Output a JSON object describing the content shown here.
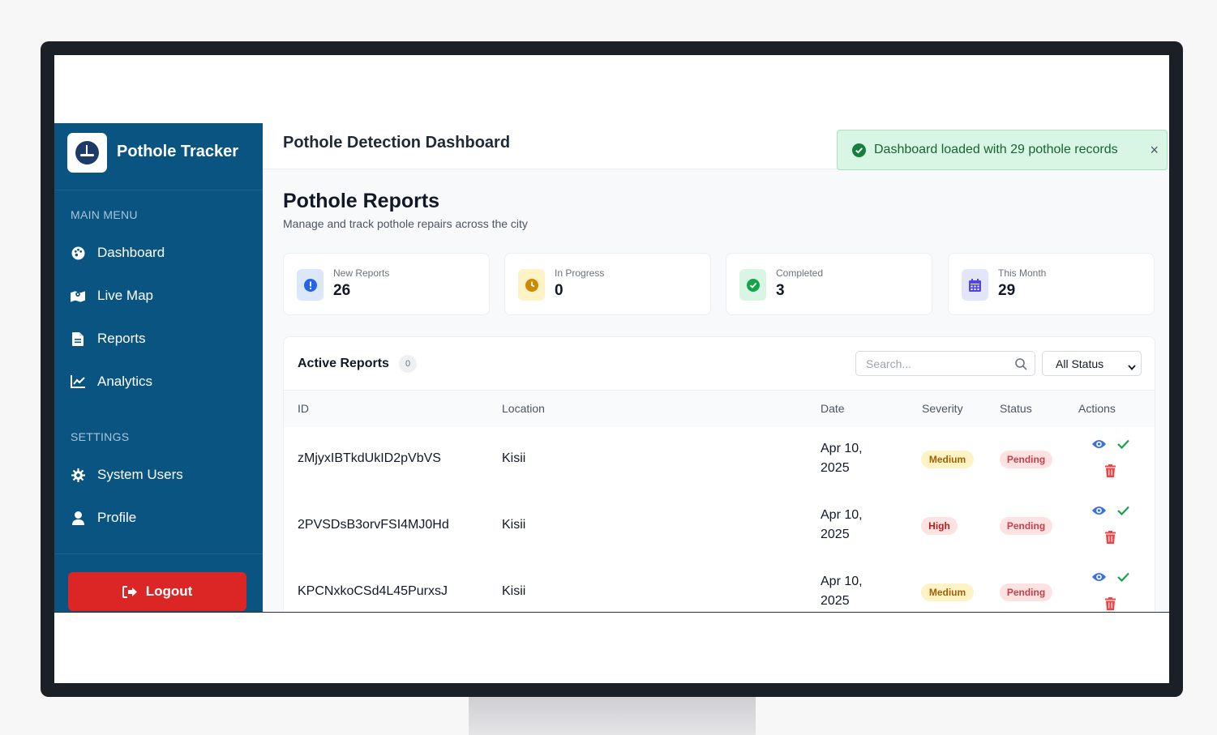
{
  "sidebar": {
    "brand": "Pothole Tracker",
    "main_menu_label": "MAIN MENU",
    "main_items": [
      {
        "label": "Dashboard",
        "icon": "palette-icon"
      },
      {
        "label": "Live Map",
        "icon": "map-icon"
      },
      {
        "label": "Reports",
        "icon": "file-icon"
      },
      {
        "label": "Analytics",
        "icon": "chart-line-icon"
      }
    ],
    "settings_label": "SETTINGS",
    "settings_items": [
      {
        "label": "System Users",
        "icon": "gear-icon"
      },
      {
        "label": "Profile",
        "icon": "user-icon"
      }
    ],
    "logout_label": "Logout"
  },
  "topbar": {
    "title": "Pothole Detection Dashboard"
  },
  "toast": {
    "message": "Dashboard loaded with 29 pothole records",
    "close": "×"
  },
  "page": {
    "title": "Pothole Reports",
    "subtitle": "Manage and track pothole repairs across the city"
  },
  "stats": [
    {
      "label": "New Reports",
      "value": "26",
      "icon": "exclamation-icon"
    },
    {
      "label": "In Progress",
      "value": "0",
      "icon": "clock-icon"
    },
    {
      "label": "Completed",
      "value": "3",
      "icon": "check-circle-icon"
    },
    {
      "label": "This Month",
      "value": "29",
      "icon": "calendar-icon"
    }
  ],
  "reports": {
    "title": "Active Reports",
    "count": "0",
    "search_placeholder": "Search...",
    "status_filter": "All Status",
    "columns": [
      "ID",
      "Location",
      "Date",
      "Severity",
      "Status",
      "Actions"
    ],
    "rows": [
      {
        "id": "zMjyxIBTkdUkID2pVbVS",
        "location": "Kisii",
        "date_line1": "Apr 10,",
        "date_line2": "2025",
        "severity": "Medium",
        "status": "Pending"
      },
      {
        "id": "2PVSDsB3orvFSI4MJ0Hd",
        "location": "Kisii",
        "date_line1": "Apr 10,",
        "date_line2": "2025",
        "severity": "High",
        "status": "Pending"
      },
      {
        "id": "KPCNxkoCSd4L45PurxsJ",
        "location": "Kisii",
        "date_line1": "Apr 10,",
        "date_line2": "2025",
        "severity": "Medium",
        "status": "Pending"
      }
    ]
  },
  "colors": {
    "sidebar": "#0a5481",
    "logout": "#dc2626",
    "toast_bg": "#d9f5e3",
    "accent_blue": "#3b6fe0"
  }
}
